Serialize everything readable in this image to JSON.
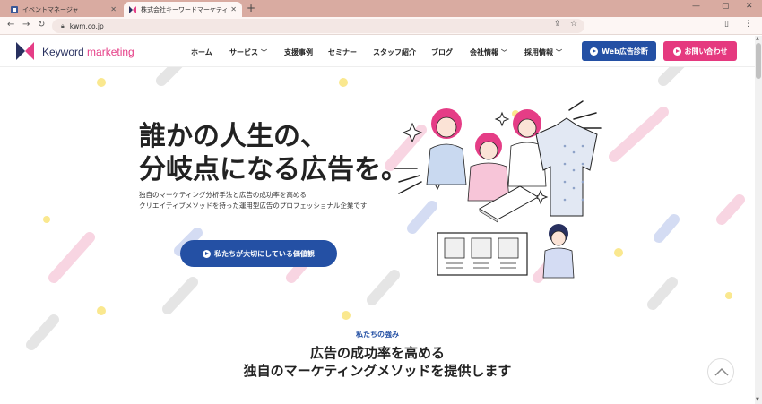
{
  "browser": {
    "tabs": [
      {
        "title": "イベントマネージャ",
        "active": false
      },
      {
        "title": "株式会社キーワードマーケティング｜ 運",
        "active": true
      }
    ],
    "new_tab": "+",
    "window_controls": {
      "minimize": "—",
      "maximize": "▢",
      "close": "✕"
    },
    "url": "kwm.co.jp"
  },
  "header": {
    "logo": {
      "word1": "Keyword",
      "word2": "marketing"
    },
    "nav": [
      {
        "label": "ホーム",
        "dropdown": false
      },
      {
        "label": "サービス",
        "dropdown": true
      },
      {
        "label": "支援事例",
        "dropdown": false
      },
      {
        "label": "セミナー",
        "dropdown": false
      },
      {
        "label": "スタッフ紹介",
        "dropdown": false
      },
      {
        "label": "ブログ",
        "dropdown": false
      },
      {
        "label": "会社情報",
        "dropdown": true
      },
      {
        "label": "採用情報",
        "dropdown": true
      }
    ],
    "cta_blue": "Web広告診断",
    "cta_pink": "お問い合わせ"
  },
  "hero": {
    "title_line1": "誰かの人生の、",
    "title_line2": "分岐点になる広告を。",
    "sub_line1": "独自のマーケティング分析手法と広告の成功率を高める",
    "sub_line2": "クリエイティブメソッドを持った運用型広告のプロフェッショナル企業です",
    "button": "私たちが大切にしている価値観"
  },
  "strength": {
    "label": "私たちの強み",
    "title_line1": "広告の成功率を高める",
    "title_line2": "独自のマーケティングメソッドを提供します"
  },
  "colors": {
    "brand_blue": "#2450a4",
    "brand_pink": "#e5397f",
    "tab_bar": "#d9aba1",
    "logo_navy": "#28305f"
  },
  "icons": [
    "back-arrow-icon",
    "forward-arrow-icon",
    "reload-icon",
    "lock-icon",
    "share-icon",
    "star-icon",
    "chevron-up-icon"
  ]
}
